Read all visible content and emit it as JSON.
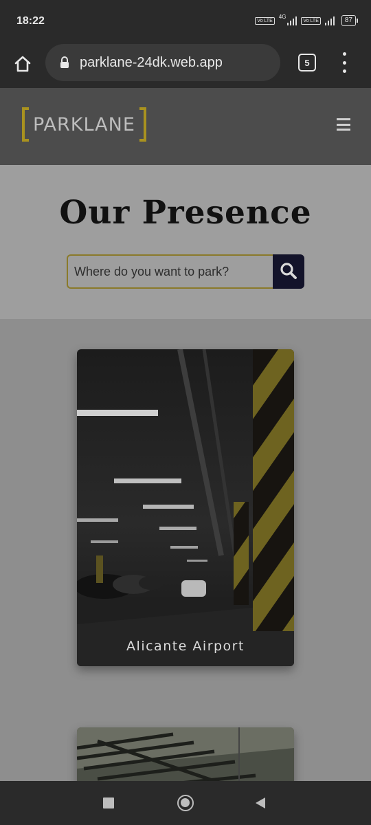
{
  "status_bar": {
    "time": "18:22",
    "network": "4G",
    "volte_1": "Vo LTE",
    "volte_2": "Vo LTE",
    "battery": "87"
  },
  "browser": {
    "url": "parklane-24dk.web.app",
    "tab_count": "5",
    "icons": [
      "home-icon",
      "lock-icon",
      "tabs-icon",
      "more-vert-icon"
    ]
  },
  "header": {
    "logo_text": "PARKLANE",
    "brand_color": "#a9921f",
    "menu_icon": "hamburger-icon"
  },
  "hero": {
    "title": "Our Presence",
    "search_placeholder": "Where do you want to park?",
    "search_icon": "search-icon",
    "search_button_color": "#13132a"
  },
  "locations": [
    {
      "name": "Alicante Airport"
    },
    {
      "name": ""
    }
  ],
  "nav_bar": {
    "icons": [
      "recent-apps-icon",
      "home-circle-icon",
      "back-icon"
    ]
  }
}
